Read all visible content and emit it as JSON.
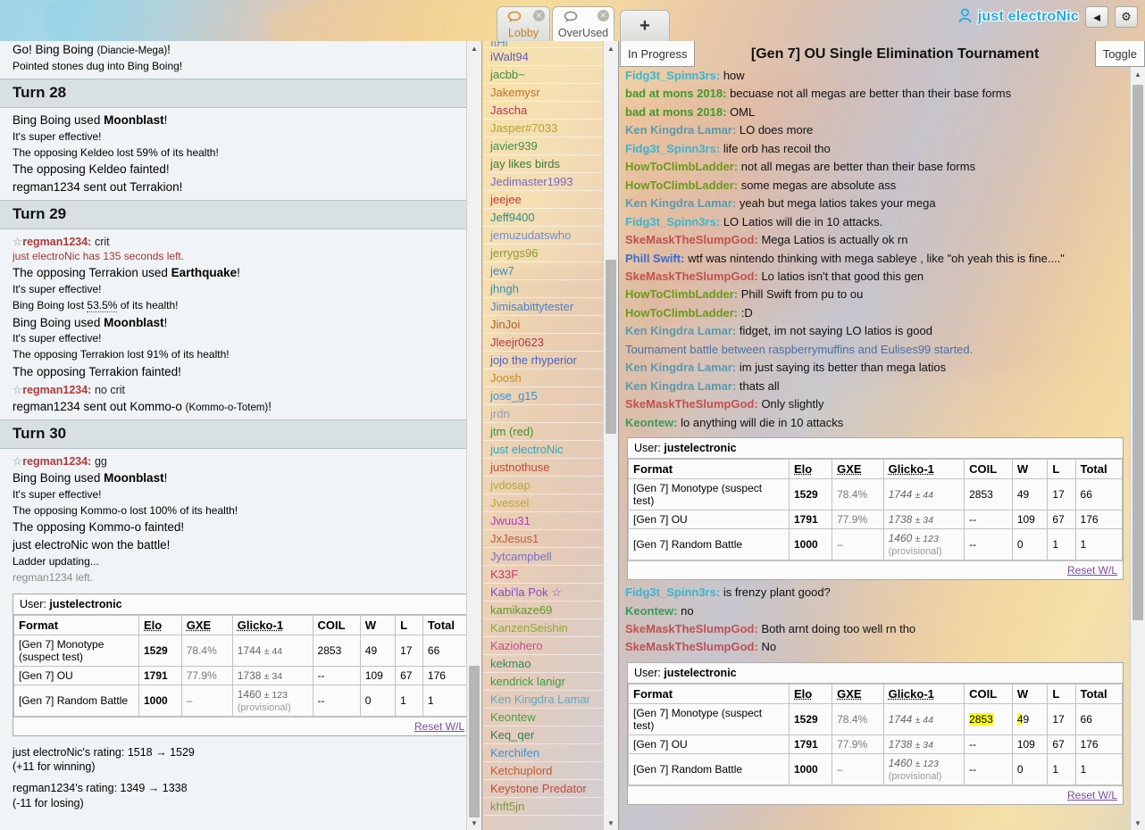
{
  "window": {
    "tabs": [
      {
        "label": "Lobby",
        "icon": "chat-icon",
        "active": false,
        "close": "×"
      },
      {
        "label": "OverUsed",
        "icon": "chat-icon",
        "active": true,
        "close": "×"
      }
    ],
    "new_tab_label": "+",
    "user": {
      "name": "just electroNic",
      "icon": "user-icon"
    },
    "volume_icon": "◄",
    "settings_icon": "⚙"
  },
  "battle_log": {
    "lines": [
      {
        "type": "text",
        "html": "Go! Bing Boing <span class='small'>(Diancie-Mega)</span>!",
        "cls": "bigline"
      },
      {
        "type": "text",
        "html": "Pointed stones dug into Bing Boing!",
        "cls": "efftext"
      },
      {
        "type": "turn",
        "text": "Turn 28"
      },
      {
        "type": "text",
        "html": "Bing Boing used <b>Moonblast</b>!",
        "cls": "bigline"
      },
      {
        "type": "text",
        "html": "It's super effective!",
        "cls": "efftext"
      },
      {
        "type": "text",
        "html": "The opposing Keldeo lost 59% of its health!",
        "cls": "efftext"
      },
      {
        "type": "text",
        "html": "The opposing Keldeo fainted!",
        "cls": "bigline"
      },
      {
        "type": "text",
        "html": "regman1234 sent out Terrakion!",
        "cls": "bigline"
      },
      {
        "type": "turn",
        "text": "Turn 29"
      },
      {
        "type": "chat",
        "user": "regman1234",
        "msg": "crit"
      },
      {
        "type": "timer",
        "text": "just electroNic has 135 seconds left."
      },
      {
        "type": "text",
        "html": "The opposing Terrakion used <b>Earthquake</b>!",
        "cls": "bigline"
      },
      {
        "type": "text",
        "html": "It's super effective!",
        "cls": "efftext"
      },
      {
        "type": "text",
        "html": "Bing Boing lost <span class='hpnum'>53.5%</span> of its health!",
        "cls": "efftext"
      },
      {
        "type": "text",
        "html": "Bing Boing used <b>Moonblast</b>!",
        "cls": "bigline"
      },
      {
        "type": "text",
        "html": "It's super effective!",
        "cls": "efftext"
      },
      {
        "type": "text",
        "html": "The opposing Terrakion lost 91% of its health!",
        "cls": "efftext"
      },
      {
        "type": "text",
        "html": "The opposing Terrakion fainted!",
        "cls": "bigline"
      },
      {
        "type": "chat",
        "user": "regman1234",
        "msg": "no crit"
      },
      {
        "type": "text",
        "html": "regman1234 sent out Kommo-o <span class='small'>(Kommo-o-Totem)</span>!",
        "cls": "bigline"
      },
      {
        "type": "turn",
        "text": "Turn 30"
      },
      {
        "type": "chat",
        "user": "regman1234",
        "msg": "gg"
      },
      {
        "type": "text",
        "html": "Bing Boing used <b>Moonblast</b>!",
        "cls": "bigline"
      },
      {
        "type": "text",
        "html": "It's super effective!",
        "cls": "efftext"
      },
      {
        "type": "text",
        "html": "The opposing Kommo-o lost 100% of its health!",
        "cls": "efftext"
      },
      {
        "type": "text",
        "html": "The opposing Kommo-o fainted!",
        "cls": "bigline"
      },
      {
        "type": "text",
        "html": "just electroNic won the battle!",
        "cls": "bigline"
      },
      {
        "type": "text",
        "html": "Ladder updating...",
        "cls": "efftext"
      },
      {
        "type": "text",
        "html": "regman1234 left.",
        "cls": "efftext graytext"
      }
    ],
    "rating_change": [
      "just electroNic's rating: 1518 → 1529",
      "(+11 for winning)",
      "regman1234's rating: 1349 → 1338",
      "(-11 for losing)"
    ]
  },
  "rating_table": {
    "user_label": "User:",
    "user_name": "justelectronic",
    "headers": [
      "Format",
      "Elo",
      "GXE",
      "Glicko-1",
      "COIL",
      "W",
      "L",
      "Total"
    ],
    "rows": [
      {
        "format": "[Gen 7] Monotype (suspect test)",
        "elo": "1529",
        "gxe": "78.4%",
        "glicko": "1744",
        "dev": "± 44",
        "prov": "",
        "coil": "2853",
        "w": "49",
        "l": "17",
        "total": "66"
      },
      {
        "format": "[Gen 7] OU",
        "elo": "1791",
        "gxe": "77.9%",
        "glicko": "1738",
        "dev": "± 34",
        "prov": "",
        "coil": "--",
        "w": "109",
        "l": "67",
        "total": "176"
      },
      {
        "format": "[Gen 7] Random Battle",
        "elo": "1000",
        "gxe": "–",
        "glicko": "1460",
        "dev": "± 123",
        "prov": "(provisional)",
        "coil": "--",
        "w": "0",
        "l": "1",
        "total": "1"
      }
    ],
    "reset_label": "Reset W/L"
  },
  "userlist": {
    "items": [
      {
        "name": "iWalt94",
        "color": "#5b5bc4",
        "cut": true
      },
      {
        "name": "jacbb~",
        "color": "#3f8c3f"
      },
      {
        "name": "Jakemysr",
        "color": "#c4702a"
      },
      {
        "name": "Jascha",
        "color": "#c43060"
      },
      {
        "name": "Jasper#7033",
        "color": "#b5a030"
      },
      {
        "name": "javier939",
        "color": "#3f8f55"
      },
      {
        "name": "jay likes birds",
        "color": "#3a7a3a"
      },
      {
        "name": "Jedimaster1993",
        "color": "#7a68c8"
      },
      {
        "name": "jeejee",
        "color": "#c43a2a"
      },
      {
        "name": "Jeff9400",
        "color": "#2f8a8a"
      },
      {
        "name": "jemuzudatswho",
        "color": "#6f8ad6"
      },
      {
        "name": "jerrygs96",
        "color": "#8a9a30"
      },
      {
        "name": "jew7",
        "color": "#3c8fc0"
      },
      {
        "name": "jhngh",
        "color": "#3a90a8"
      },
      {
        "name": "Jimisabittytester",
        "color": "#4a7fc8"
      },
      {
        "name": "JinJoi",
        "color": "#b06030"
      },
      {
        "name": "Jleejr0623",
        "color": "#b03a4a"
      },
      {
        "name": "jojo the rhyperior",
        "color": "#4a5fc8"
      },
      {
        "name": "Joosh",
        "color": "#c48a2a"
      },
      {
        "name": "jose_g15",
        "color": "#3a8fd0"
      },
      {
        "name": "jrdn",
        "color": "#8f9fb5"
      },
      {
        "name": "jtm (red)",
        "color": "#3f8f3f"
      },
      {
        "name": "just electroNic",
        "color": "#2aa8c8",
        "self": true
      },
      {
        "name": "justnothuse",
        "color": "#c04a3a"
      },
      {
        "name": "jvdosap",
        "color": "#b5a83a"
      },
      {
        "name": "Jvessel",
        "color": "#c0a530"
      },
      {
        "name": "Jwuu31",
        "color": "#b03ac0"
      },
      {
        "name": "JxJesus1",
        "color": "#c45a3a"
      },
      {
        "name": "Jytcampbell",
        "color": "#7a6fc8"
      },
      {
        "name": "K33F",
        "color": "#c03a6a"
      },
      {
        "name": "Kabi'la Pok ☆",
        "color": "#8a4ac8"
      },
      {
        "name": "kamikaze69",
        "color": "#5a9a2a"
      },
      {
        "name": "KanzenSeishin",
        "color": "#8aa83a"
      },
      {
        "name": "Kaziohero",
        "color": "#c44a8a"
      },
      {
        "name": "kekmao",
        "color": "#2f8a6a"
      },
      {
        "name": "kendrick lanigr",
        "color": "#3f9a3f"
      },
      {
        "name": "Ken Kingdra Lamar",
        "color": "#5fa8c0"
      },
      {
        "name": "Keontew",
        "color": "#4a9a4a"
      },
      {
        "name": "Keq_qer",
        "color": "#3a7a5a"
      },
      {
        "name": "Kerchifen",
        "color": "#3a8fe0"
      },
      {
        "name": "Ketchuplord",
        "color": "#c45a2a"
      },
      {
        "name": "Keystone Predator",
        "color": "#c04a3a"
      },
      {
        "name": "khft5jn",
        "color": "#7a9a3a"
      }
    ]
  },
  "tournament": {
    "status": "In Progress",
    "title": "[Gen 7] OU Single Elimination Tournament",
    "toggle_label": "Toggle"
  },
  "chat": {
    "messages": [
      {
        "user": "Fidg3t_Spinn3rs",
        "color": "#3ab5d0",
        "text": "how"
      },
      {
        "user": "bad at mons 2018",
        "color": "#3f9a2a",
        "text": "becuase not all megas are better than their base forms"
      },
      {
        "user": "bad at mons 2018",
        "color": "#3f9a2a",
        "text": "OML"
      },
      {
        "user": "Ken Kingdra Lamar",
        "color": "#5a9ab0",
        "text": "LO does more"
      },
      {
        "user": "Fidg3t_Spinn3rs",
        "color": "#3ab5d0",
        "text": "life orb has recoil tho"
      },
      {
        "user": "HowToClimbLadder",
        "color": "#6a9a1a",
        "text": "not all megas are better than their base forms"
      },
      {
        "user": "HowToClimbLadder",
        "color": "#6a9a1a",
        "text": "some megas are absolute ass"
      },
      {
        "user": "Ken Kingdra Lamar",
        "color": "#5a9ab0",
        "text": "yeah but mega latios takes your mega"
      },
      {
        "user": "Fidg3t_Spinn3rs",
        "color": "#3ab5d0",
        "text": "LO Latios will die in 10 attacks."
      },
      {
        "user": "SkeMaskTheSlumpGod",
        "color": "#c05050",
        "text": "Mega Latios is actually ok rn"
      },
      {
        "user": "Phill Swift",
        "color": "#3a6ad0",
        "text": "wtf was nintendo thinking with mega sableye , like \"oh yeah this is fine....\""
      },
      {
        "user": "SkeMaskTheSlumpGod",
        "color": "#c05050",
        "text": "Lo latios isn't that good this gen"
      },
      {
        "user": "HowToClimbLadder",
        "color": "#6a9a1a",
        "text": "Phill Swift from pu to ou"
      },
      {
        "user": "HowToClimbLadder",
        "color": "#6a9a1a",
        "text": ":D"
      },
      {
        "user": "Ken Kingdra Lamar",
        "color": "#5a9ab0",
        "text": "fidget, im not saying LO latios is good"
      },
      {
        "notice": "Tournament battle between raspberrymuffins and Eulises99 started."
      },
      {
        "user": "Ken Kingdra Lamar",
        "color": "#5a9ab0",
        "text": "im just saying its better than mega latios"
      },
      {
        "user": "Ken Kingdra Lamar",
        "color": "#5a9ab0",
        "text": "thats all"
      },
      {
        "user": "SkeMaskTheSlumpGod",
        "color": "#c05050",
        "text": "Only slightly"
      },
      {
        "user": "Keontew",
        "color": "#3a9a5a",
        "text": "lo anything will die in 10 attacks"
      }
    ],
    "messages2": [
      {
        "user": "Fidg3t_Spinn3rs",
        "color": "#3ab5d0",
        "text": "is frenzy plant good?"
      },
      {
        "user": "Keontew",
        "color": "#3a9a5a",
        "text": "no"
      },
      {
        "user": "SkeMaskTheSlumpGod",
        "color": "#c05050",
        "text": "Both arnt doing too well rn tho"
      },
      {
        "user": "SkeMaskTheSlumpGod",
        "color": "#c05050",
        "text": "No"
      }
    ]
  },
  "highlight": {
    "color": "#ffff00",
    "value": "2853"
  }
}
